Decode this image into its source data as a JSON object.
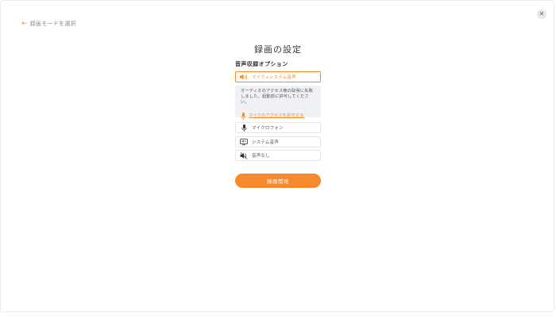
{
  "nav": {
    "back_label": "録画モードを選択"
  },
  "dialog": {
    "title": "録画の設定",
    "section_label": "音声収録オプション",
    "options": [
      {
        "label": "マイク+システム音声",
        "icon": "speaker-icon",
        "selected": true
      },
      {
        "label": "マイクロフォン",
        "icon": "microphone-icon",
        "selected": false
      },
      {
        "label": "システム音声",
        "icon": "monitor-speaker-icon",
        "selected": false
      },
      {
        "label": "音声なし",
        "icon": "speaker-muted-icon",
        "selected": false
      }
    ],
    "notice": {
      "message": "オーディオのアクセス権の取得に失敗しました。起動前に許可してください。",
      "link_label": "マイクのアクセスを許可する"
    },
    "start_label": "録画開始"
  },
  "colors": {
    "accent": "#f5892b",
    "notice_bg": "#f0f1f4",
    "text": "#333333"
  }
}
